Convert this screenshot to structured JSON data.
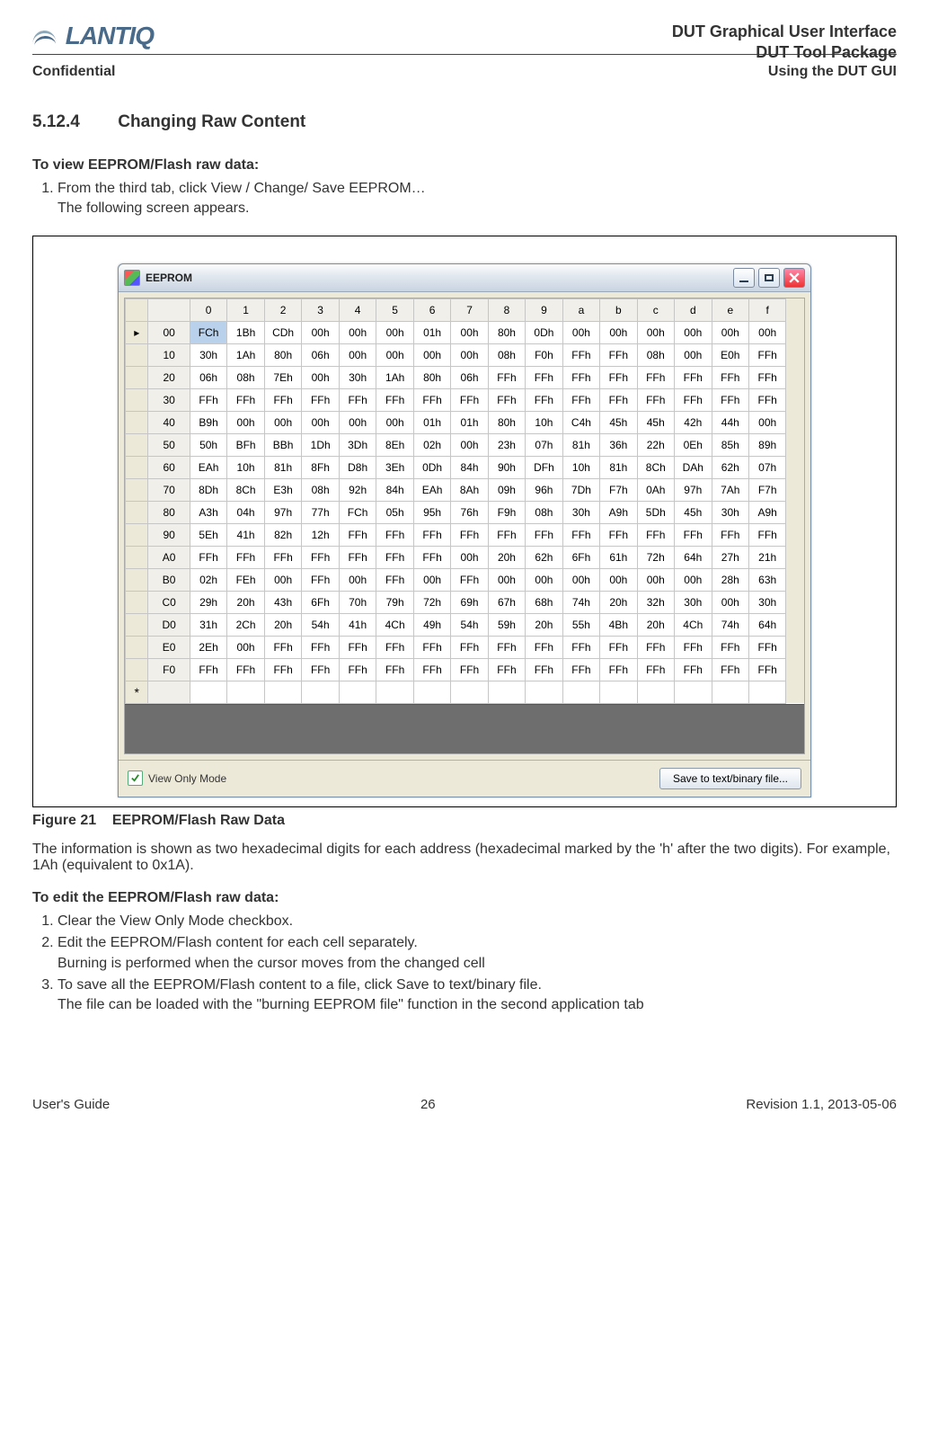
{
  "header": {
    "logo_text": "LANTIQ",
    "line1": "DUT Graphical User Interface",
    "line2": "DUT Tool Package",
    "confidential": "Confidential",
    "section_path": "Using the DUT GUI"
  },
  "heading": {
    "number": "5.12.4",
    "title": "Changing Raw Content"
  },
  "intro_view": {
    "lead": "To view EEPROM/Flash raw data:",
    "step1": "From the third tab, click View / Change/ Save EEPROM…",
    "step1_line2": "The following screen appears."
  },
  "window": {
    "title": "EEPROM",
    "view_only_label": "View Only Mode",
    "view_only_checked": true,
    "save_button": "Save to text/binary file..."
  },
  "hex": {
    "col_headers": [
      "0",
      "1",
      "2",
      "3",
      "4",
      "5",
      "6",
      "7",
      "8",
      "9",
      "a",
      "b",
      "c",
      "d",
      "e",
      "f"
    ],
    "row_headers": [
      "00",
      "10",
      "20",
      "30",
      "40",
      "50",
      "60",
      "70",
      "80",
      "90",
      "A0",
      "B0",
      "C0",
      "D0",
      "E0",
      "F0"
    ],
    "rows": [
      [
        "FCh",
        "1Bh",
        "CDh",
        "00h",
        "00h",
        "00h",
        "01h",
        "00h",
        "80h",
        "0Dh",
        "00h",
        "00h",
        "00h",
        "00h",
        "00h",
        "00h"
      ],
      [
        "30h",
        "1Ah",
        "80h",
        "06h",
        "00h",
        "00h",
        "00h",
        "00h",
        "08h",
        "F0h",
        "FFh",
        "FFh",
        "08h",
        "00h",
        "E0h",
        "FFh"
      ],
      [
        "06h",
        "08h",
        "7Eh",
        "00h",
        "30h",
        "1Ah",
        "80h",
        "06h",
        "FFh",
        "FFh",
        "FFh",
        "FFh",
        "FFh",
        "FFh",
        "FFh",
        "FFh"
      ],
      [
        "FFh",
        "FFh",
        "FFh",
        "FFh",
        "FFh",
        "FFh",
        "FFh",
        "FFh",
        "FFh",
        "FFh",
        "FFh",
        "FFh",
        "FFh",
        "FFh",
        "FFh",
        "FFh"
      ],
      [
        "B9h",
        "00h",
        "00h",
        "00h",
        "00h",
        "00h",
        "01h",
        "01h",
        "80h",
        "10h",
        "C4h",
        "45h",
        "45h",
        "42h",
        "44h",
        "00h"
      ],
      [
        "50h",
        "BFh",
        "BBh",
        "1Dh",
        "3Dh",
        "8Eh",
        "02h",
        "00h",
        "23h",
        "07h",
        "81h",
        "36h",
        "22h",
        "0Eh",
        "85h",
        "89h"
      ],
      [
        "EAh",
        "10h",
        "81h",
        "8Fh",
        "D8h",
        "3Eh",
        "0Dh",
        "84h",
        "90h",
        "DFh",
        "10h",
        "81h",
        "8Ch",
        "DAh",
        "62h",
        "07h"
      ],
      [
        "8Dh",
        "8Ch",
        "E3h",
        "08h",
        "92h",
        "84h",
        "EAh",
        "8Ah",
        "09h",
        "96h",
        "7Dh",
        "F7h",
        "0Ah",
        "97h",
        "7Ah",
        "F7h"
      ],
      [
        "A3h",
        "04h",
        "97h",
        "77h",
        "FCh",
        "05h",
        "95h",
        "76h",
        "F9h",
        "08h",
        "30h",
        "A9h",
        "5Dh",
        "45h",
        "30h",
        "A9h"
      ],
      [
        "5Eh",
        "41h",
        "82h",
        "12h",
        "FFh",
        "FFh",
        "FFh",
        "FFh",
        "FFh",
        "FFh",
        "FFh",
        "FFh",
        "FFh",
        "FFh",
        "FFh",
        "FFh"
      ],
      [
        "FFh",
        "FFh",
        "FFh",
        "FFh",
        "FFh",
        "FFh",
        "FFh",
        "00h",
        "20h",
        "62h",
        "6Fh",
        "61h",
        "72h",
        "64h",
        "27h",
        "21h"
      ],
      [
        "02h",
        "FEh",
        "00h",
        "FFh",
        "00h",
        "FFh",
        "00h",
        "FFh",
        "00h",
        "00h",
        "00h",
        "00h",
        "00h",
        "00h",
        "28h",
        "63h"
      ],
      [
        "29h",
        "20h",
        "43h",
        "6Fh",
        "70h",
        "79h",
        "72h",
        "69h",
        "67h",
        "68h",
        "74h",
        "20h",
        "32h",
        "30h",
        "00h",
        "30h"
      ],
      [
        "31h",
        "2Ch",
        "20h",
        "54h",
        "41h",
        "4Ch",
        "49h",
        "54h",
        "59h",
        "20h",
        "55h",
        "4Bh",
        "20h",
        "4Ch",
        "74h",
        "64h"
      ],
      [
        "2Eh",
        "00h",
        "FFh",
        "FFh",
        "FFh",
        "FFh",
        "FFh",
        "FFh",
        "FFh",
        "FFh",
        "FFh",
        "FFh",
        "FFh",
        "FFh",
        "FFh",
        "FFh"
      ],
      [
        "FFh",
        "FFh",
        "FFh",
        "FFh",
        "FFh",
        "FFh",
        "FFh",
        "FFh",
        "FFh",
        "FFh",
        "FFh",
        "FFh",
        "FFh",
        "FFh",
        "FFh",
        "FFh"
      ]
    ],
    "selected_marker": "▸",
    "newrow_marker": "*"
  },
  "figure_caption": {
    "prefix": "Figure 21",
    "title": "EEPROM/Flash Raw Data"
  },
  "post_figure_text": "The information is shown as two hexadecimal digits for each address (hexadecimal marked by the 'h' after the two digits). For example, 1Ah (equivalent to 0x1A).",
  "edit_section": {
    "lead": "To edit the EEPROM/Flash raw data:",
    "step1": "Clear the View Only Mode checkbox.",
    "step2": "Edit the EEPROM/Flash content for each cell separately.",
    "step2_line2": "Burning is performed when the cursor moves from the changed cell",
    "step3": "To save all the EEPROM/Flash content to a file, click Save to text/binary file.",
    "step3_line2": "The file can be loaded with the \"burning EEPROM file\" function in the second application tab"
  },
  "footer": {
    "left": "User's Guide",
    "center": "26",
    "right": "Revision 1.1, 2013-05-06"
  }
}
